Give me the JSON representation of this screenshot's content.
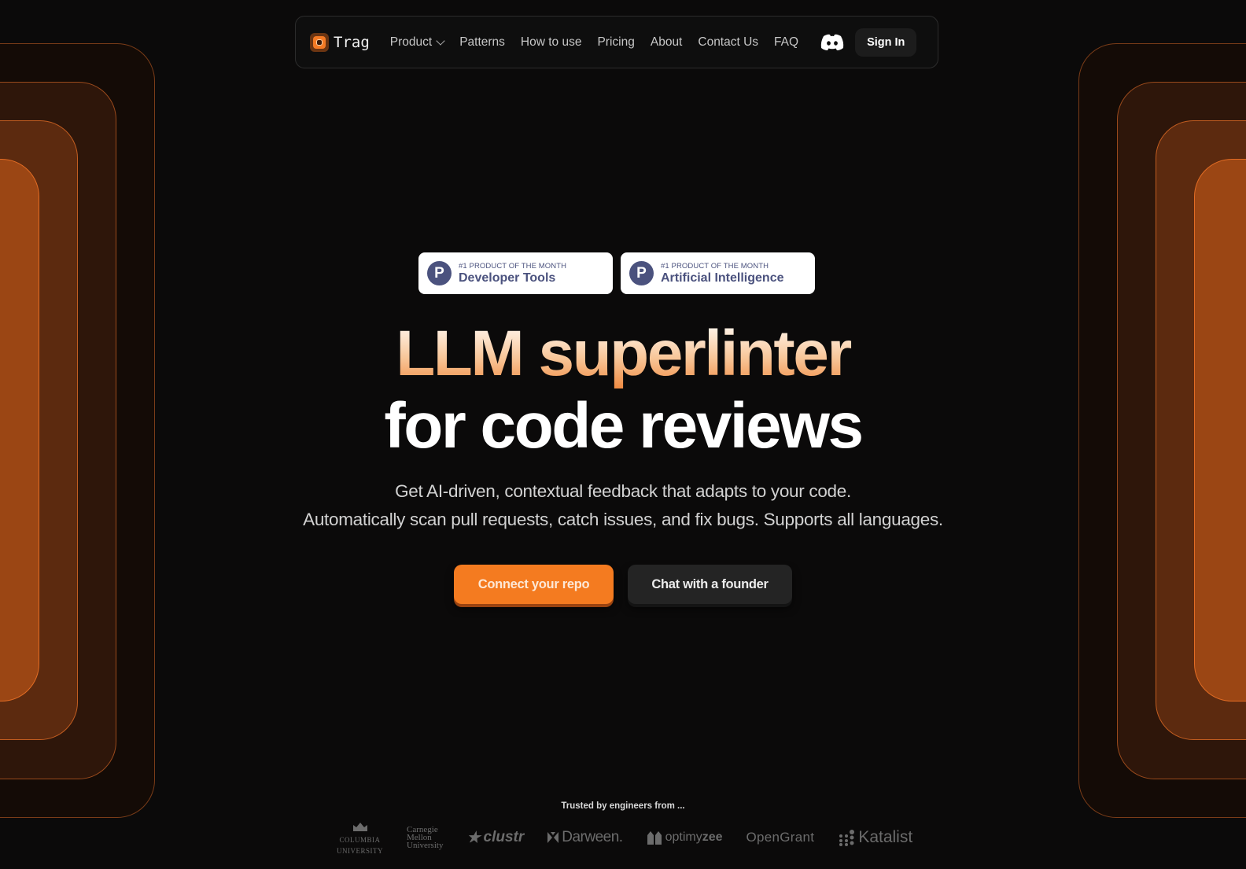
{
  "nav": {
    "brand": "Trag",
    "links": [
      {
        "label": "Product",
        "has_dropdown": true
      },
      {
        "label": "Patterns"
      },
      {
        "label": "How to use"
      },
      {
        "label": "Pricing"
      },
      {
        "label": "About"
      },
      {
        "label": "Contact Us"
      },
      {
        "label": "FAQ"
      }
    ],
    "discord_icon": "discord-icon",
    "sign_in_label": "Sign In"
  },
  "badges": [
    {
      "icon": "P",
      "eyebrow": "#1 PRODUCT OF THE MONTH",
      "title": "Developer Tools"
    },
    {
      "icon": "P",
      "eyebrow": "#1 PRODUCT OF THE MONTH",
      "title": "Artificial Intelligence"
    }
  ],
  "hero": {
    "line1": "LLM superlinter",
    "line2": "for code reviews",
    "subtitle_line1": "Get AI-driven, contextual feedback that adapts to your code.",
    "subtitle_line2": "Automatically scan pull requests, catch issues, and fix bugs. Supports all languages.",
    "primary_cta": "Connect your repo",
    "secondary_cta": "Chat with a founder"
  },
  "trusted": {
    "label": "Trusted by engineers from ...",
    "logos": {
      "columbia_line1": "COLUMBIA",
      "columbia_line2": "UNIVERSITY",
      "cmu_line1": "Carnegie",
      "cmu_line2": "Mellon",
      "cmu_line3": "University",
      "clustr": "clustr",
      "darween": "Darween.",
      "optimyzee_a": "optimy",
      "optimyzee_b": "zee",
      "opengrant": "OpenGrant",
      "katalist": "Katalist"
    }
  },
  "colors": {
    "accent": "#f47b20",
    "badge_text": "#4b527e",
    "background": "#0b0a0a"
  }
}
